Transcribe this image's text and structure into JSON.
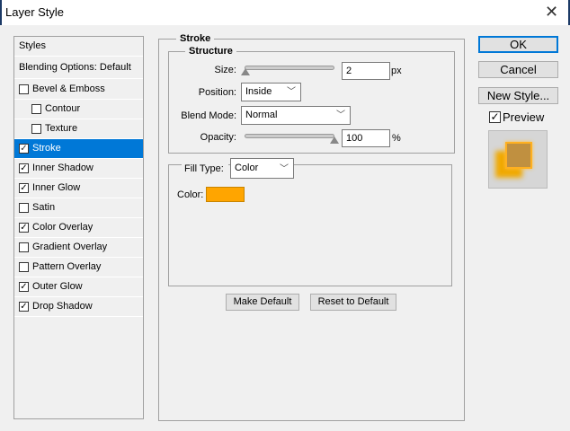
{
  "window": {
    "title": "Layer Style",
    "close_icon": "close-icon"
  },
  "styles_list": {
    "header": "Styles",
    "blending": "Blending Options: Default",
    "items": [
      {
        "label": "Bevel & Emboss",
        "checked": false,
        "sub": false
      },
      {
        "label": "Contour",
        "checked": false,
        "sub": true
      },
      {
        "label": "Texture",
        "checked": false,
        "sub": true
      },
      {
        "label": "Stroke",
        "checked": true,
        "sub": false,
        "selected": true
      },
      {
        "label": "Inner Shadow",
        "checked": true,
        "sub": false
      },
      {
        "label": "Inner Glow",
        "checked": true,
        "sub": false
      },
      {
        "label": "Satin",
        "checked": false,
        "sub": false
      },
      {
        "label": "Color Overlay",
        "checked": true,
        "sub": false
      },
      {
        "label": "Gradient Overlay",
        "checked": false,
        "sub": false
      },
      {
        "label": "Pattern Overlay",
        "checked": false,
        "sub": false
      },
      {
        "label": "Outer Glow",
        "checked": true,
        "sub": false
      },
      {
        "label": "Drop Shadow",
        "checked": true,
        "sub": false
      }
    ]
  },
  "stroke": {
    "title": "Stroke",
    "structure": {
      "title": "Structure",
      "size_label": "Size:",
      "size_value": "2",
      "size_unit": "px",
      "position_label": "Position:",
      "position_value": "Inside",
      "blend_label": "Blend Mode:",
      "blend_value": "Normal",
      "opacity_label": "Opacity:",
      "opacity_value": "100",
      "opacity_unit": "%"
    },
    "fill": {
      "type_label": "Fill Type:",
      "type_value": "Color",
      "color_label": "Color:",
      "color": "#ffa500"
    },
    "make_default": "Make Default",
    "reset_default": "Reset to Default"
  },
  "actions": {
    "ok": "OK",
    "cancel": "Cancel",
    "new_style": "New Style...",
    "preview_label": "Preview",
    "preview_checked": true
  },
  "colors": {
    "selection": "#0078d7",
    "accent": "#ffa500"
  }
}
